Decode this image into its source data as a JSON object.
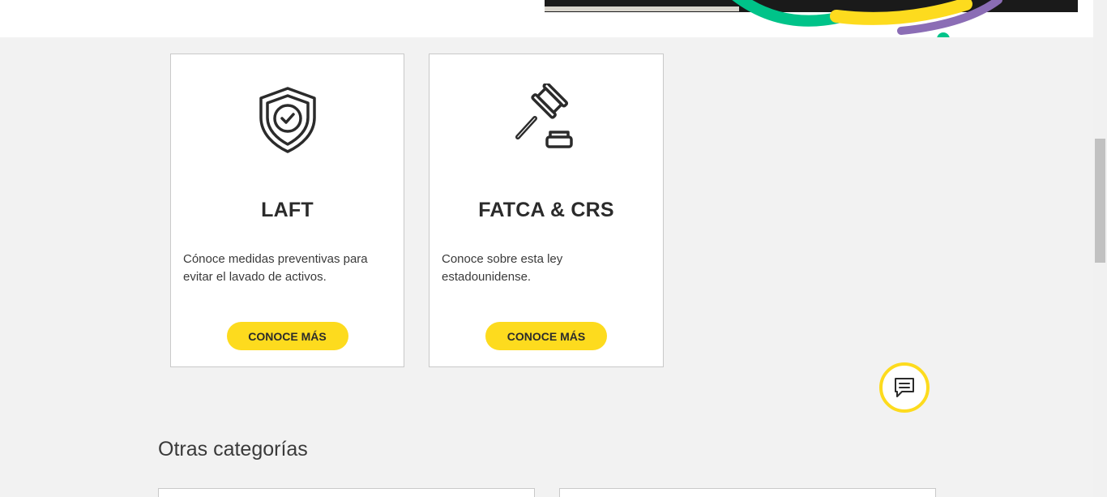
{
  "cards": [
    {
      "title": "LAFT",
      "description": "Cónoce medidas preventivas para evitar el lavado de activos.",
      "button_label": "CONOCE MÁS",
      "icon": "shield-check-icon"
    },
    {
      "title": "FATCA & CRS",
      "description": "Conoce sobre esta ley estadounidense.",
      "button_label": "CONOCE MÁS",
      "icon": "gavel-icon"
    }
  ],
  "chat": {
    "icon": "chat-icon"
  },
  "other_categories": {
    "heading": "Otras categorías"
  },
  "colors": {
    "accent_yellow": "#fddb1e",
    "hero_green": "#00c389",
    "hero_purple": "#8b6db5",
    "background": "#f2f2f2"
  }
}
